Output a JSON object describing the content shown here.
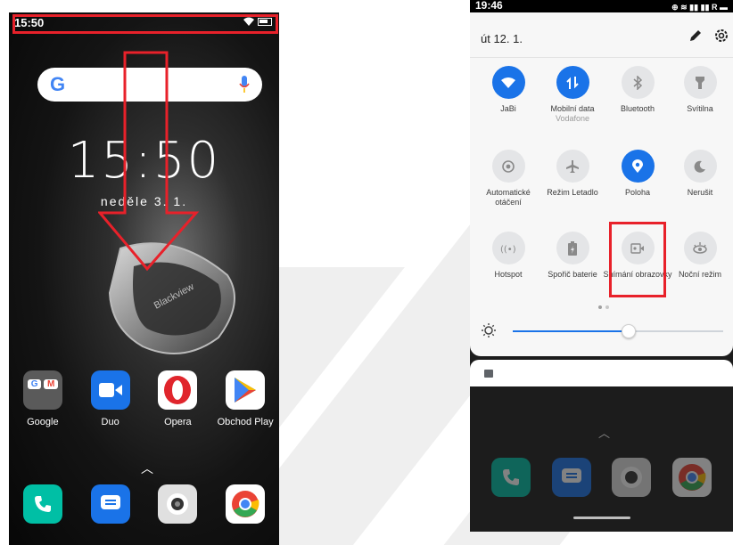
{
  "left_phone": {
    "status_time": "15:50",
    "clock": "15:50",
    "date": "neděle 3. 1.",
    "search_letter": "G",
    "apps": [
      {
        "label": "Google",
        "icon": "google-folder-icon"
      },
      {
        "label": "Duo",
        "icon": "duo-icon"
      },
      {
        "label": "Opera",
        "icon": "opera-icon"
      },
      {
        "label": "Obchod Play",
        "icon": "play-store-icon"
      }
    ],
    "dock": [
      "phone-icon",
      "messages-icon",
      "camera-icon",
      "chrome-icon"
    ]
  },
  "right_phone": {
    "status_time": "19:46",
    "status_icons": "⊕ ≋ ▮▮ ▮▮ R ▬",
    "panel_date": "út 12. 1.",
    "tiles": [
      {
        "label": "JaBi",
        "sub": "",
        "state": "on",
        "icon": "wifi-icon"
      },
      {
        "label": "Mobilní data",
        "sub": "Vodafone",
        "state": "on",
        "icon": "mobile-data-icon"
      },
      {
        "label": "Bluetooth",
        "sub": "",
        "state": "off",
        "icon": "bluetooth-icon"
      },
      {
        "label": "Svítilna",
        "sub": "",
        "state": "off",
        "icon": "flashlight-icon"
      },
      {
        "label": "Automatické otáčení",
        "sub": "",
        "state": "off",
        "icon": "auto-rotate-icon"
      },
      {
        "label": "Režim Letadlo",
        "sub": "",
        "state": "off",
        "icon": "airplane-icon"
      },
      {
        "label": "Poloha",
        "sub": "",
        "state": "on",
        "icon": "location-icon"
      },
      {
        "label": "Nerušit",
        "sub": "",
        "state": "off",
        "icon": "do-not-disturb-icon"
      },
      {
        "label": "Hotspot",
        "sub": "",
        "state": "off",
        "icon": "hotspot-icon"
      },
      {
        "label": "Spořič baterie",
        "sub": "",
        "state": "off",
        "icon": "battery-saver-icon"
      },
      {
        "label": "Snímání obrazovky",
        "sub": "",
        "state": "off",
        "icon": "screen-record-icon"
      },
      {
        "label": "Noční režim",
        "sub": "",
        "state": "off",
        "icon": "night-mode-icon"
      }
    ],
    "brightness_level": 0.55,
    "accent": "#1a73e8"
  },
  "highlight_color": "#e8212a"
}
